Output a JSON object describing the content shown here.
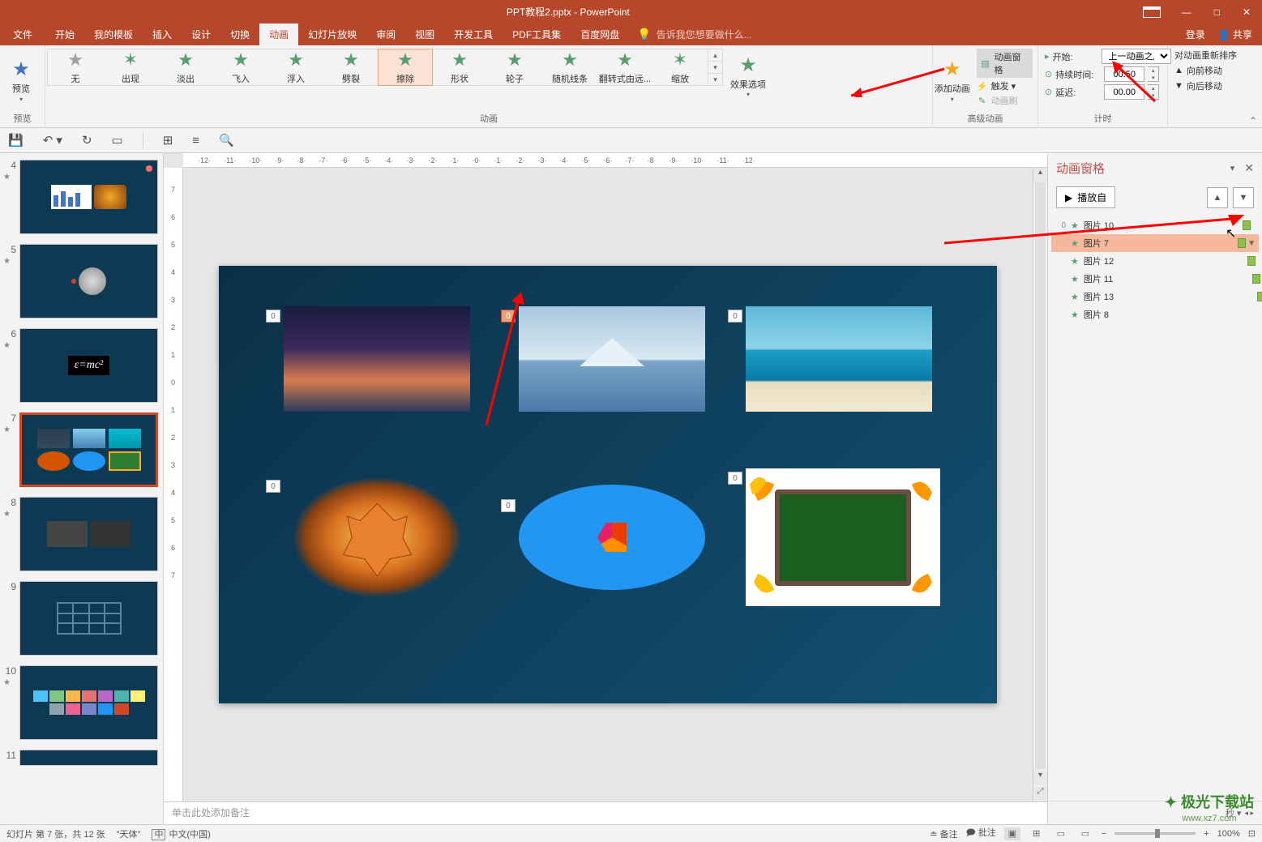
{
  "title": "PPT教程2.pptx - PowerPoint",
  "window_controls": {
    "min": "—",
    "max": "□",
    "close": "✕"
  },
  "menubar": {
    "file": "文件",
    "tabs": [
      "开始",
      "我的模板",
      "插入",
      "设计",
      "切换",
      "动画",
      "幻灯片放映",
      "审阅",
      "视图",
      "开发工具",
      "PDF工具集",
      "百度网盘"
    ],
    "active_index": 5,
    "tell_me": "告诉我您想要做什么...",
    "login": "登录",
    "share": "共享"
  },
  "ribbon": {
    "preview": {
      "label": "预览",
      "group": "预览"
    },
    "animations": {
      "group": "动画",
      "items": [
        "无",
        "出现",
        "淡出",
        "飞入",
        "浮入",
        "劈裂",
        "擦除",
        "形状",
        "轮子",
        "随机线条",
        "翻转式由远...",
        "缩放"
      ],
      "selected_index": 6,
      "effect_options": "效果选项"
    },
    "advanced": {
      "group": "高级动画",
      "add": "添加动画",
      "pane": "动画窗格",
      "trigger": "触发 ▾",
      "painter": "动画刷"
    },
    "timing": {
      "group": "计时",
      "start_label": "开始:",
      "start_value": "上一动画之后",
      "duration_label": "持续时间:",
      "duration_value": "00.50",
      "delay_label": "延迟:",
      "delay_value": "00.00"
    },
    "reorder": {
      "title": "对动画重新排序",
      "forward": "向前移动",
      "backward": "向后移动"
    }
  },
  "qat_tooltips": [
    "保存",
    "撤销",
    "重做",
    "从头开始",
    "插入表格",
    "对齐",
    "文本框",
    "查找"
  ],
  "thumbnails": {
    "visible": [
      4,
      5,
      6,
      7,
      8,
      9,
      10,
      11
    ],
    "active": 7
  },
  "slide_anim_tags": [
    "0",
    "0",
    "0",
    "0",
    "0",
    "0"
  ],
  "notes_placeholder": "单击此处添加备注",
  "anim_pane": {
    "title": "动画窗格",
    "play": "播放自",
    "items": [
      {
        "seq": "0",
        "name": "图片 10",
        "selected": false
      },
      {
        "seq": "",
        "name": "图片 7",
        "selected": true
      },
      {
        "seq": "",
        "name": "图片 12",
        "selected": false
      },
      {
        "seq": "",
        "name": "图片 11",
        "selected": false
      },
      {
        "seq": "",
        "name": "图片 13",
        "selected": false
      },
      {
        "seq": "",
        "name": "图片 8",
        "selected": false
      }
    ],
    "footer": "秒 ▾"
  },
  "statusbar": {
    "slide": "幻灯片 第 7 张，共 12 张",
    "theme": "\"天体\"",
    "lang_icon": "中",
    "lang": "中文(中国)",
    "notes": "备注",
    "comments": "批注",
    "zoom": "100%"
  },
  "ruler_h_ticks": [
    "12",
    "11",
    "10",
    "9",
    "8",
    "7",
    "6",
    "5",
    "4",
    "3",
    "2",
    "1",
    "0",
    "1",
    "2",
    "3",
    "4",
    "5",
    "6",
    "7",
    "8",
    "9",
    "10",
    "11",
    "12"
  ],
  "ruler_v_ticks": [
    "7",
    "6",
    "5",
    "4",
    "3",
    "2",
    "1",
    "0",
    "1",
    "2",
    "3",
    "4",
    "5",
    "6",
    "7"
  ],
  "watermark": {
    "line1": "极光下载站",
    "line2": "www.xz7.com"
  }
}
